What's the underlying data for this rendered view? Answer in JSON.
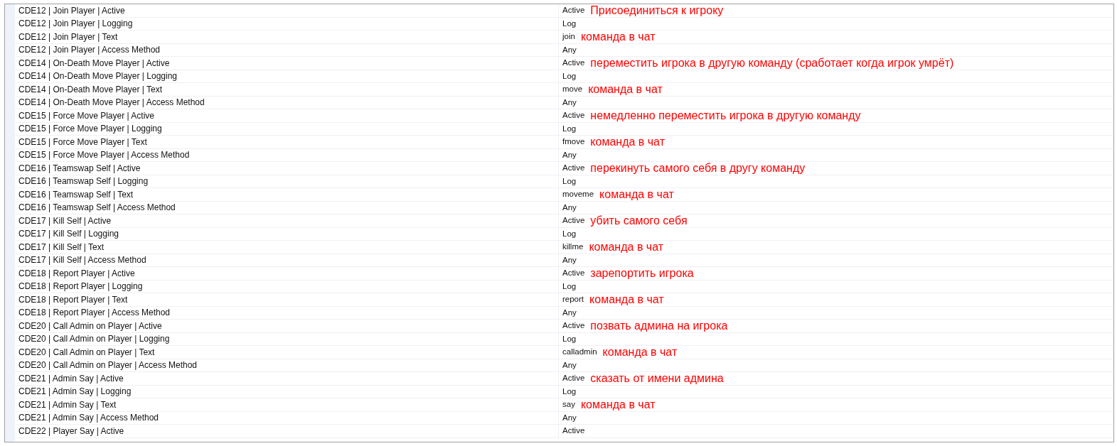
{
  "rows": [
    {
      "name": "CDE12 | Join Player | Active",
      "value": "Active",
      "note": "Присоединиться к игроку"
    },
    {
      "name": "CDE12 | Join Player | Logging",
      "value": "Log"
    },
    {
      "name": "CDE12 | Join Player | Text",
      "value": "join",
      "note": "команда в чат"
    },
    {
      "name": "CDE12 | Join Player | Access Method",
      "value": "Any"
    },
    {
      "name": "CDE14 | On-Death Move Player | Active",
      "value": "Active",
      "note": "переместить игрока в другую команду (сработает когда игрок умрёт)"
    },
    {
      "name": "CDE14 | On-Death Move Player | Logging",
      "value": "Log"
    },
    {
      "name": "CDE14 | On-Death Move Player | Text",
      "value": "move",
      "note": "команда в чат"
    },
    {
      "name": "CDE14 | On-Death Move Player | Access Method",
      "value": "Any"
    },
    {
      "name": "CDE15 | Force Move Player | Active",
      "value": "Active",
      "note": "немедленно переместить игрока в другую команду"
    },
    {
      "name": "CDE15 | Force Move Player | Logging",
      "value": "Log"
    },
    {
      "name": "CDE15 | Force Move Player | Text",
      "value": "fmove",
      "note": "команда в чат"
    },
    {
      "name": "CDE15 | Force Move Player | Access Method",
      "value": "Any"
    },
    {
      "name": "CDE16 | Teamswap Self | Active",
      "value": "Active",
      "note": "перекинуть самого себя в другу команду"
    },
    {
      "name": "CDE16 | Teamswap Self | Logging",
      "value": "Log"
    },
    {
      "name": "CDE16 | Teamswap Self | Text",
      "value": "moveme",
      "note": "команда в чат"
    },
    {
      "name": "CDE16 | Teamswap Self | Access Method",
      "value": "Any"
    },
    {
      "name": "CDE17 | Kill Self | Active",
      "value": "Active",
      "note": "убить самого себя"
    },
    {
      "name": "CDE17 | Kill Self | Logging",
      "value": "Log"
    },
    {
      "name": "CDE17 | Kill Self | Text",
      "value": "killme",
      "note": "команда в чат"
    },
    {
      "name": "CDE17 | Kill Self | Access Method",
      "value": "Any"
    },
    {
      "name": "CDE18 | Report Player | Active",
      "value": "Active",
      "note": "зарепортить игрока"
    },
    {
      "name": "CDE18 | Report Player | Logging",
      "value": "Log"
    },
    {
      "name": "CDE18 | Report Player | Text",
      "value": "report",
      "note": "команда в чат"
    },
    {
      "name": "CDE18 | Report Player | Access Method",
      "value": "Any"
    },
    {
      "name": "CDE20 | Call Admin on Player | Active",
      "value": "Active",
      "note": "позвать админа на игрока"
    },
    {
      "name": "CDE20 | Call Admin on Player | Logging",
      "value": "Log"
    },
    {
      "name": "CDE20 | Call Admin on Player | Text",
      "value": "calladmin",
      "note": "команда в чат"
    },
    {
      "name": "CDE20 | Call Admin on Player | Access Method",
      "value": "Any"
    },
    {
      "name": "CDE21 | Admin Say | Active",
      "value": "Active",
      "note": "сказать от имени админа"
    },
    {
      "name": "CDE21 | Admin Say | Logging",
      "value": "Log"
    },
    {
      "name": "CDE21 | Admin Say | Text",
      "value": "say",
      "note": "команда в чат"
    },
    {
      "name": "CDE21 | Admin Say | Access Method",
      "value": "Any"
    },
    {
      "name": "CDE22 | Player Say | Active",
      "value": "Active"
    }
  ]
}
